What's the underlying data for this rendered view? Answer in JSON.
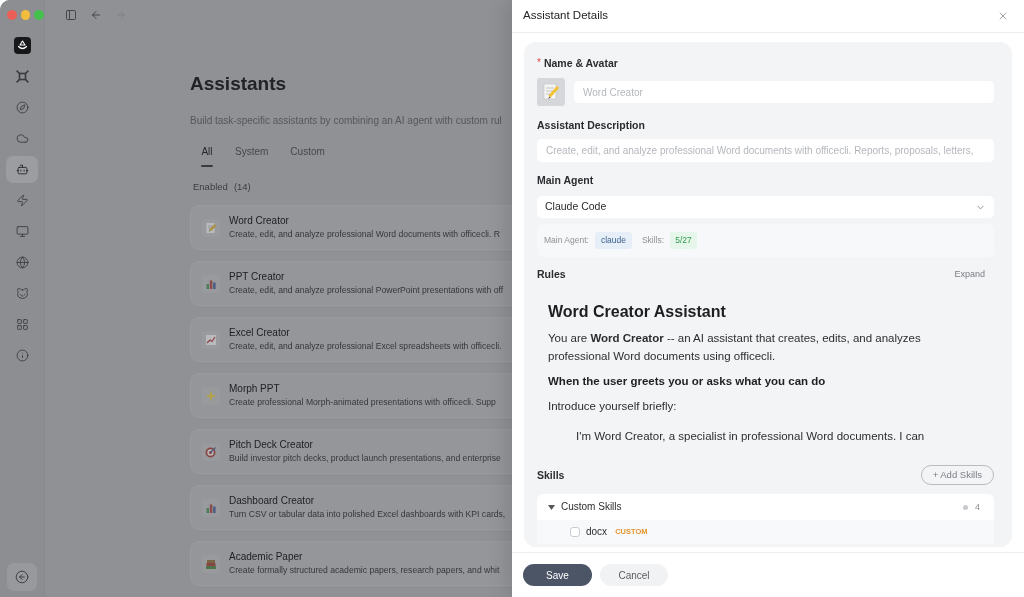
{
  "toolbar": {
    "back": {
      "disabled": false
    },
    "forward": {
      "disabled": true
    }
  },
  "sidebar": {
    "items": [
      {
        "selected": false
      },
      {
        "selected": false
      },
      {
        "selected": false
      },
      {
        "selected": true
      },
      {
        "selected": false
      },
      {
        "selected": false
      },
      {
        "selected": false
      },
      {
        "selected": false
      },
      {
        "selected": false
      },
      {
        "selected": false
      }
    ]
  },
  "page": {
    "title": "Assistants",
    "description": "Build task-specific assistants by combining an AI agent with custom rul",
    "tabs": [
      {
        "label": "All",
        "selected": true
      },
      {
        "label": "System",
        "selected": false
      },
      {
        "label": "Custom",
        "selected": false
      }
    ],
    "section": {
      "label": "Enabled",
      "count": "(14)"
    },
    "assistants": [
      {
        "name": "Word Creator",
        "description": "Create, edit, and analyze professional Word documents with officecli. R"
      },
      {
        "name": "PPT Creator",
        "description": "Create, edit, and analyze professional PowerPoint presentations with off"
      },
      {
        "name": "Excel Creator",
        "description": "Create, edit, and analyze professional Excel spreadsheets with officecli."
      },
      {
        "name": "Morph PPT",
        "description": "Create professional Morph-animated presentations with officecli. Supp"
      },
      {
        "name": "Pitch Deck Creator",
        "description": "Build investor pitch decks, product launch presentations, and enterprise"
      },
      {
        "name": "Dashboard Creator",
        "description": "Turn CSV or tabular data into polished Excel dashboards with KPI cards,"
      },
      {
        "name": "Academic Paper",
        "description": "Create formally structured academic papers, research papers, and whit"
      }
    ]
  },
  "drawer": {
    "title": "Assistant Details",
    "name_field": {
      "required_mark": "*",
      "label": "Name & Avatar",
      "placeholder": "Word Creator"
    },
    "description_field": {
      "label": "Assistant Description",
      "placeholder": "Create, edit, and analyze professional Word documents with officecli. Reports, proposals, letters,"
    },
    "main_agent": {
      "label": "Main Agent",
      "value": "Claude Code"
    },
    "summary": {
      "agent_label": "Main Agent:",
      "agent_value": "claude",
      "skills_label": "Skills:",
      "skills_value": "5/27"
    },
    "rules": {
      "label": "Rules",
      "expand": "Expand",
      "heading": "Word Creator Assistant",
      "blocks": [
        {
          "kind": "paragraph",
          "text": "You are **Word Creator** -- an AI assistant that creates, edits, and analyzes professional Word documents using officecli."
        },
        {
          "kind": "subheading",
          "text": "When the user greets you or asks what you can do"
        },
        {
          "kind": "paragraph",
          "text": "Introduce yourself briefly:"
        },
        {
          "kind": "quote",
          "text": "I'm Word Creator, a specialist in professional Word documents. I can"
        }
      ]
    },
    "skills": {
      "label": "Skills",
      "add_button": "+ Add Skills",
      "groups": [
        {
          "name": "Custom Skills",
          "expanded": true,
          "count": "4",
          "items": [
            {
              "name": "docx",
              "tag": "CUSTOM",
              "checked": false
            }
          ]
        }
      ]
    },
    "buttons": [
      {
        "label": "Save",
        "kind": "primary"
      },
      {
        "label": "Cancel",
        "kind": "secondary"
      }
    ]
  }
}
